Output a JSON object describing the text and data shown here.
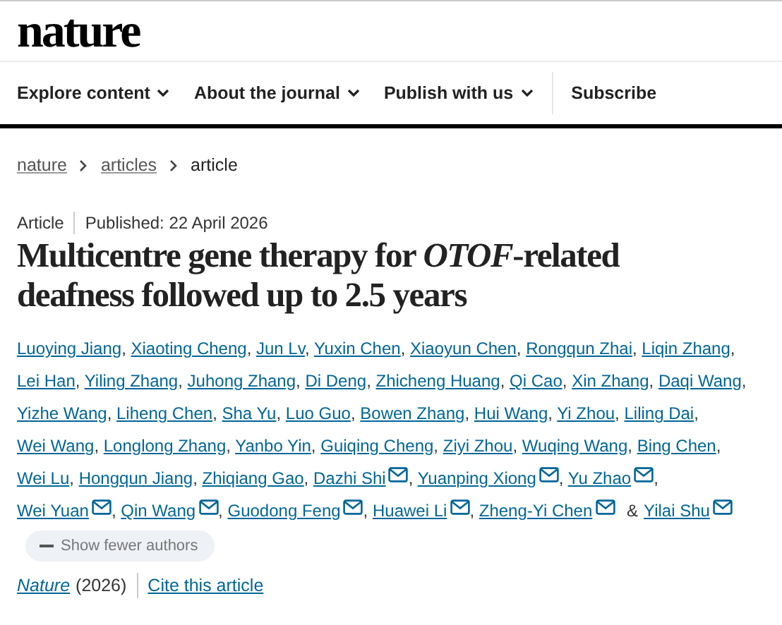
{
  "site": {
    "logo": "nature"
  },
  "nav": [
    {
      "label": "Explore content",
      "dropdown": true
    },
    {
      "label": "About the journal",
      "dropdown": true
    },
    {
      "label": "Publish with us",
      "dropdown": true
    },
    {
      "label": "Subscribe",
      "dropdown": false
    }
  ],
  "breadcrumb": [
    {
      "label": "nature",
      "link": true
    },
    {
      "label": "articles",
      "link": true
    },
    {
      "label": "article",
      "link": false
    }
  ],
  "article": {
    "type": "Article",
    "published": "Published: 22 April 2026",
    "title": "Multicentre gene therapy for *OTOF*-related deafness followed up to 2.5 years",
    "authors": [
      {
        "name": "Luoying Jiang",
        "corresponding": false
      },
      {
        "name": "Xiaoting Cheng",
        "corresponding": false
      },
      {
        "name": "Jun Lv",
        "corresponding": false
      },
      {
        "name": "Yuxin Chen",
        "corresponding": false
      },
      {
        "name": "Xiaoyun Chen",
        "corresponding": false
      },
      {
        "name": "Rongqun Zhai",
        "corresponding": false
      },
      {
        "name": "Liqin Zhang",
        "corresponding": false
      },
      {
        "name": "Lei Han",
        "corresponding": false
      },
      {
        "name": "Yiling Zhang",
        "corresponding": false
      },
      {
        "name": "Juhong Zhang",
        "corresponding": false
      },
      {
        "name": "Di Deng",
        "corresponding": false
      },
      {
        "name": "Zhicheng Huang",
        "corresponding": false
      },
      {
        "name": "Qi Cao",
        "corresponding": false
      },
      {
        "name": "Xin Zhang",
        "corresponding": false
      },
      {
        "name": "Daqi Wang",
        "corresponding": false
      },
      {
        "name": "Yizhe Wang",
        "corresponding": false
      },
      {
        "name": "Liheng Chen",
        "corresponding": false
      },
      {
        "name": "Sha Yu",
        "corresponding": false
      },
      {
        "name": "Luo Guo",
        "corresponding": false
      },
      {
        "name": "Bowen Zhang",
        "corresponding": false
      },
      {
        "name": "Hui Wang",
        "corresponding": false
      },
      {
        "name": "Yi Zhou",
        "corresponding": false
      },
      {
        "name": "Liling Dai",
        "corresponding": false
      },
      {
        "name": "Wei Wang",
        "corresponding": false
      },
      {
        "name": "Longlong Zhang",
        "corresponding": false
      },
      {
        "name": "Yanbo Yin",
        "corresponding": false
      },
      {
        "name": "Guiqing Cheng",
        "corresponding": false
      },
      {
        "name": "Ziyi Zhou",
        "corresponding": false
      },
      {
        "name": "Wuqing Wang",
        "corresponding": false
      },
      {
        "name": "Bing Chen",
        "corresponding": false
      },
      {
        "name": "Wei Lu",
        "corresponding": false
      },
      {
        "name": "Hongqun Jiang",
        "corresponding": false
      },
      {
        "name": "Zhiqiang Gao",
        "corresponding": false
      },
      {
        "name": "Dazhi Shi",
        "corresponding": true
      },
      {
        "name": "Yuanping Xiong",
        "corresponding": true
      },
      {
        "name": "Yu Zhao",
        "corresponding": true
      },
      {
        "name": "Wei Yuan",
        "corresponding": true
      },
      {
        "name": "Qin Wang",
        "corresponding": true
      },
      {
        "name": "Guodong Feng",
        "corresponding": true
      },
      {
        "name": "Huawei Li",
        "corresponding": true
      },
      {
        "name": "Zheng-Yi Chen",
        "corresponding": true
      },
      {
        "name": "Yilai Shu",
        "corresponding": true
      }
    ],
    "separator": ",",
    "last_separator": "&",
    "toggle_authors": "Show fewer authors",
    "journal": "Nature",
    "year": "(2026)",
    "cite": "Cite this article"
  }
}
